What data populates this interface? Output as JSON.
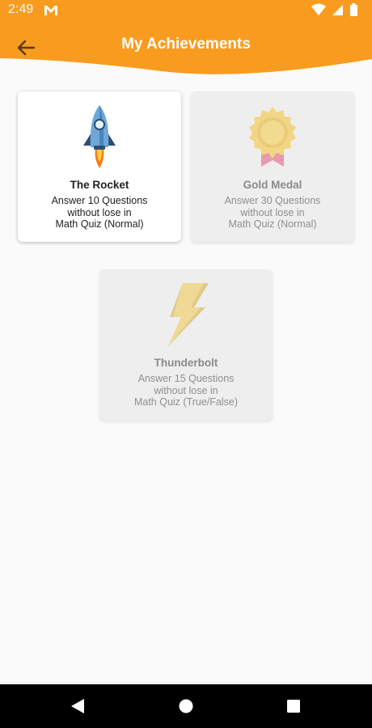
{
  "status_bar": {
    "time": "2:49"
  },
  "header": {
    "title": "My Achievements",
    "accent_color": "#f99b1f"
  },
  "achievements": [
    {
      "title": "The Rocket",
      "description": "Answer 10 Questions\nwithout lose in\nMath Quiz (Normal)",
      "icon": "rocket-icon",
      "unlocked": true
    },
    {
      "title": "Gold Medal",
      "description": "Answer 30 Questions\nwithout lose in\nMath Quiz (Normal)",
      "icon": "gold-medal-icon",
      "unlocked": false
    },
    {
      "title": "Thunderbolt",
      "description": "Answer 15 Questions\nwithout lose in\nMath Quiz (True/False)",
      "icon": "thunderbolt-icon",
      "unlocked": false
    }
  ],
  "nav_bar": {
    "back": "back-triangle-icon",
    "home": "home-circle-icon",
    "recents": "recents-square-icon"
  }
}
